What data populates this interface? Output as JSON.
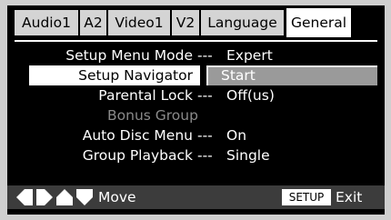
{
  "tabs": [
    {
      "label": "Audio1",
      "active": false
    },
    {
      "label": "A2",
      "active": false
    },
    {
      "label": "Video1",
      "active": false
    },
    {
      "label": "V2",
      "active": false
    },
    {
      "label": "Language",
      "active": false
    },
    {
      "label": "General",
      "active": true
    }
  ],
  "menu": {
    "setup_menu_mode": {
      "label": "Setup Menu Mode",
      "sep": "---",
      "value": "Expert"
    },
    "setup_navigator": {
      "label": "Setup Navigator",
      "value": "Start"
    },
    "parental_lock": {
      "label": "Parental Lock",
      "sep": "---",
      "value": "Off(us)"
    },
    "bonus_group": {
      "label": "Bonus Group"
    },
    "auto_disc_menu": {
      "label": "Auto Disc Menu",
      "sep": "---",
      "value": "On"
    },
    "group_playback": {
      "label": "Group Playback",
      "sep": "---",
      "value": "Single"
    }
  },
  "footer": {
    "move_icon": "dpad-arrows-icon",
    "move_label": "Move",
    "setup_key": "SETUP",
    "exit_label": "Exit"
  },
  "colors": {
    "background": "#000000",
    "tab": "#d4d4d4",
    "tab_active": "#ffffff",
    "highlight": "#ffffff",
    "value_button": "#9a9a9a",
    "dim_text": "#8a8a8a",
    "footer": "#3c3c3c"
  }
}
